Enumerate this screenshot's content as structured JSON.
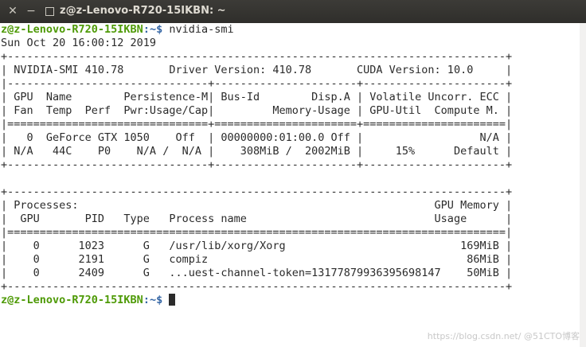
{
  "window": {
    "title": "z@z-Lenovo-R720-15IKBN: ~",
    "close_glyph": "✕",
    "minimize_glyph": "−"
  },
  "prompt": {
    "user_host": "z@z-Lenovo-R720-15IKBN",
    "path": ":~$",
    "command": " nvidia-smi"
  },
  "output_lines": [
    "Sun Oct 20 16:00:12 2019",
    "+-----------------------------------------------------------------------------+",
    "| NVIDIA-SMI 410.78       Driver Version: 410.78       CUDA Version: 10.0     |",
    "|-------------------------------+----------------------+----------------------+",
    "| GPU  Name        Persistence-M| Bus-Id        Disp.A | Volatile Uncorr. ECC |",
    "| Fan  Temp  Perf  Pwr:Usage/Cap|         Memory-Usage | GPU-Util  Compute M. |",
    "|===============================+======================+======================|",
    "|   0  GeForce GTX 1050    Off  | 00000000:01:00.0 Off |                  N/A |",
    "| N/A   44C    P0    N/A /  N/A |    308MiB /  2002MiB |     15%      Default |",
    "+-------------------------------+----------------------+----------------------+",
    "",
    "+-----------------------------------------------------------------------------+",
    "| Processes:                                                       GPU Memory |",
    "|  GPU       PID   Type   Process name                             Usage      |",
    "|=============================================================================|",
    "|    0      1023      G   /usr/lib/xorg/Xorg                           169MiB |",
    "|    0      2191      G   compiz                                        86MiB |",
    "|    0      2409      G   ...uest-channel-token=13177879936395698147    50MiB |",
    "+-----------------------------------------------------------------------------+"
  ],
  "final_prompt": {
    "user_host": "z@z-Lenovo-R720-15IKBN",
    "path": ":~$"
  },
  "watermark": "https://blog.csdn.net/ @51CTO博客",
  "colors": {
    "prompt_user": "#4e9a06",
    "prompt_path": "#3465a4",
    "titlebar": "#3c3b37"
  }
}
